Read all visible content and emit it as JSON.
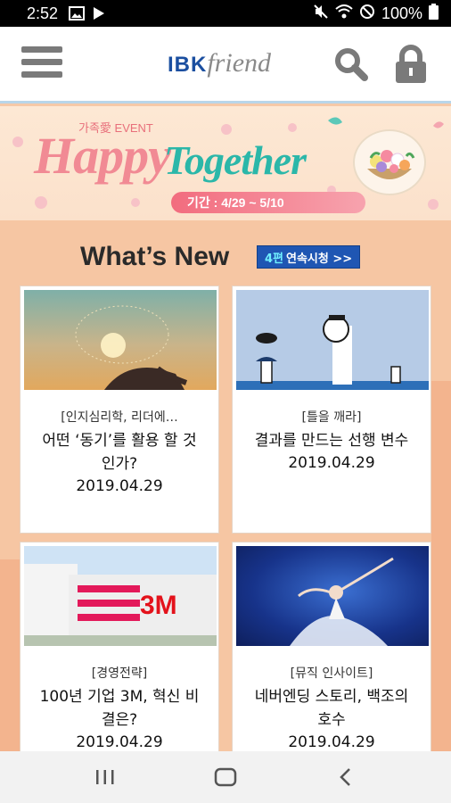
{
  "status": {
    "time": "2:52",
    "battery": "100%"
  },
  "header": {
    "logo_ibk": "IBK",
    "logo_friend": "friend"
  },
  "banner": {
    "kicker": "가족愛 EVENT",
    "title_1": "Happy",
    "title_2": "Together",
    "period": "기간 : 4/29 ~ 5/10"
  },
  "whats_new": {
    "title": "What’s New",
    "badge_num": "4편",
    "badge_text": "연속시청 >>"
  },
  "cards": [
    {
      "category": "[인지심리학, 리더에…",
      "title": "어떤 ‘동기’를 활용 할 것인가?",
      "date": "2019.04.29"
    },
    {
      "category": "[틀을 깨라]",
      "title": "결과를 만드는 선행 변수",
      "date": "2019.04.29"
    },
    {
      "category": "[경영전략]",
      "title": "100년 기업 3M, 혁신 비결은?",
      "date": "2019.04.29"
    },
    {
      "category": "[뮤직 인사이트]",
      "title": "네버엔딩 스토리, 백조의 호수",
      "date": "2019.04.29"
    }
  ],
  "thumb_text": {
    "brand_3m": "3M"
  },
  "colors": {
    "brand_blue": "#1b4fa0",
    "badge_blue": "#1f56b3",
    "banner_pink": "#f18a94",
    "banner_teal": "#2bb7a9",
    "content_bg": "#f6c6a3"
  }
}
